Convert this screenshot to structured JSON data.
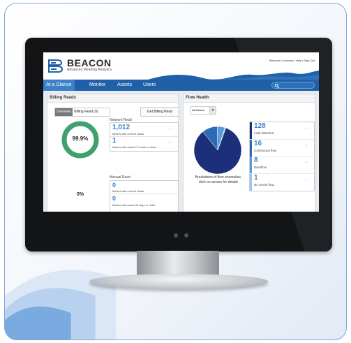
{
  "app": {
    "brand": "BEACON",
    "tagline": "Advanced Metering Analytics",
    "welcome": "Welcome Customer | Help | Sign Out"
  },
  "nav": {
    "tabs": [
      "At a Glance",
      "Monitor",
      "Assets",
      "Users"
    ],
    "active": 0
  },
  "billing": {
    "title": "Billing Reads",
    "tab_overview": "Overview",
    "tab_billing_read": "Billing Read (0)",
    "get_button": "Get Billing Read",
    "network_title": "Network Read",
    "network_percent": "99.9%",
    "network_percent_value": 99.9,
    "network_current_count": "1,012",
    "network_current_label": "Meters with current reads.",
    "network_old_count": "1",
    "network_old_label": "Meters with reads 72 hours or older.",
    "manual_title": "Manual Read",
    "manual_percent": "0%",
    "manual_current_count": "0",
    "manual_current_label": "Meters with current reads.",
    "manual_old_count": "0",
    "manual_old_label": "Meters with reads 30 days or older."
  },
  "flow": {
    "title": "Flow Health",
    "filter": "All Meters",
    "caption": "Breakdown of flow anomalies, click on arrows for details",
    "items": [
      {
        "count": "128",
        "label": "Leak detected",
        "value": 128,
        "color": "#1d2f7a"
      },
      {
        "count": "16",
        "label": "Continuous flow",
        "value": 16,
        "color": "#2d6ab6"
      },
      {
        "count": "8",
        "label": "Backflow",
        "value": 8,
        "color": "#5b9ad8"
      },
      {
        "count": "1",
        "label": "No recent flow",
        "value": 1,
        "color": "#9cc4ec"
      }
    ]
  },
  "icons": {
    "arrow": "→",
    "search": "search-icon",
    "dropdown": "chevron-down-icon"
  }
}
